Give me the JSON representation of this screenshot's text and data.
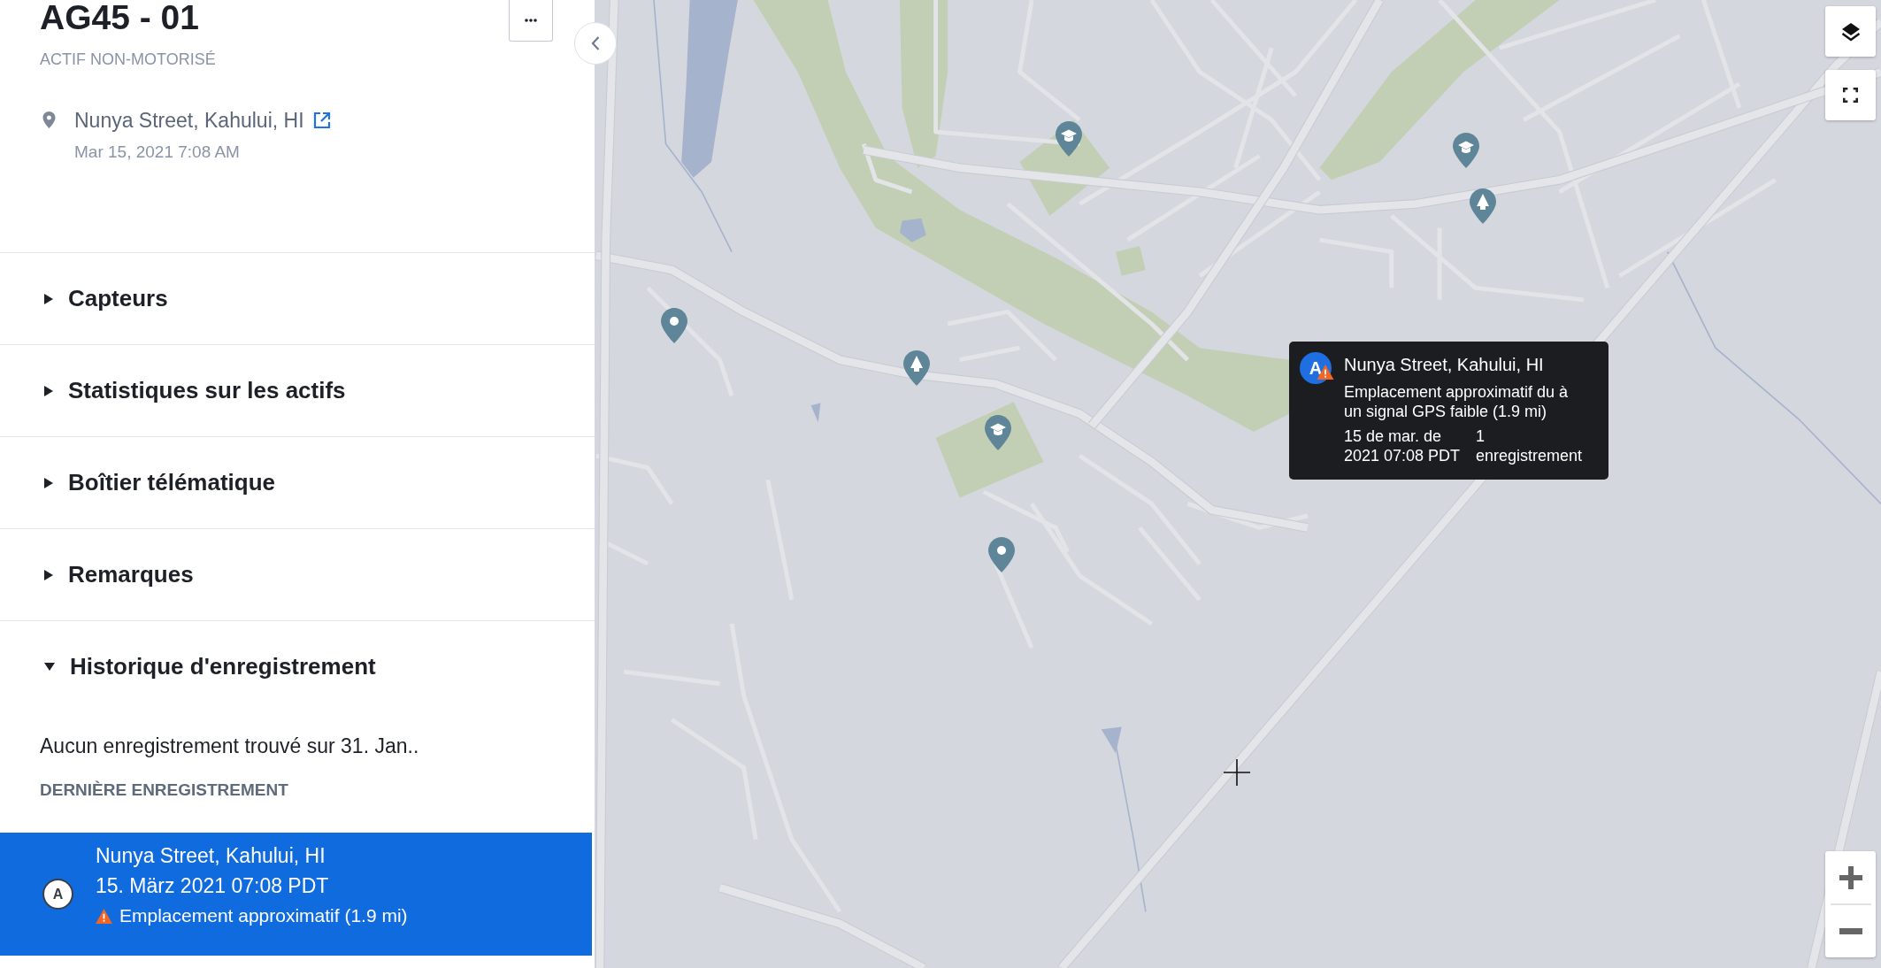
{
  "panel": {
    "title": "AG45 - 01",
    "subtitle": "ACTIF NON-MOTORISÉ",
    "address": "Nunya Street, Kahului, HI",
    "timestamp": "Mar 15, 2021 7:08 AM"
  },
  "sections": [
    {
      "label": "Capteurs",
      "expanded": false
    },
    {
      "label": "Statistiques sur les actifs",
      "expanded": false
    },
    {
      "label": "Boîtier télématique",
      "expanded": false
    },
    {
      "label": "Remarques",
      "expanded": false
    },
    {
      "label": "Historique d'enregistrement",
      "expanded": true,
      "body": {
        "empty_message": "Aucun enregistrement trouvé sur 31. Jan..",
        "heading": "DERNIÈRE ENREGISTREMENT",
        "records": [
          {
            "marker": "A",
            "address": "Nunya Street, Kahului, HI",
            "time": "15. März 2021 07:08 PDT",
            "warning": "Emplacement approximatif (1.9 mi)",
            "selected": true
          }
        ]
      }
    }
  ],
  "map": {
    "tooltip": {
      "marker": "A",
      "approximate": true,
      "title": "Nunya Street, Kahului, HI",
      "message": "Emplacement approximatif du à un signal GPS faible (1.9 mi)",
      "time": "15 de mar. de 2021 07:08 PDT",
      "count": "1 enregistrement"
    }
  }
}
